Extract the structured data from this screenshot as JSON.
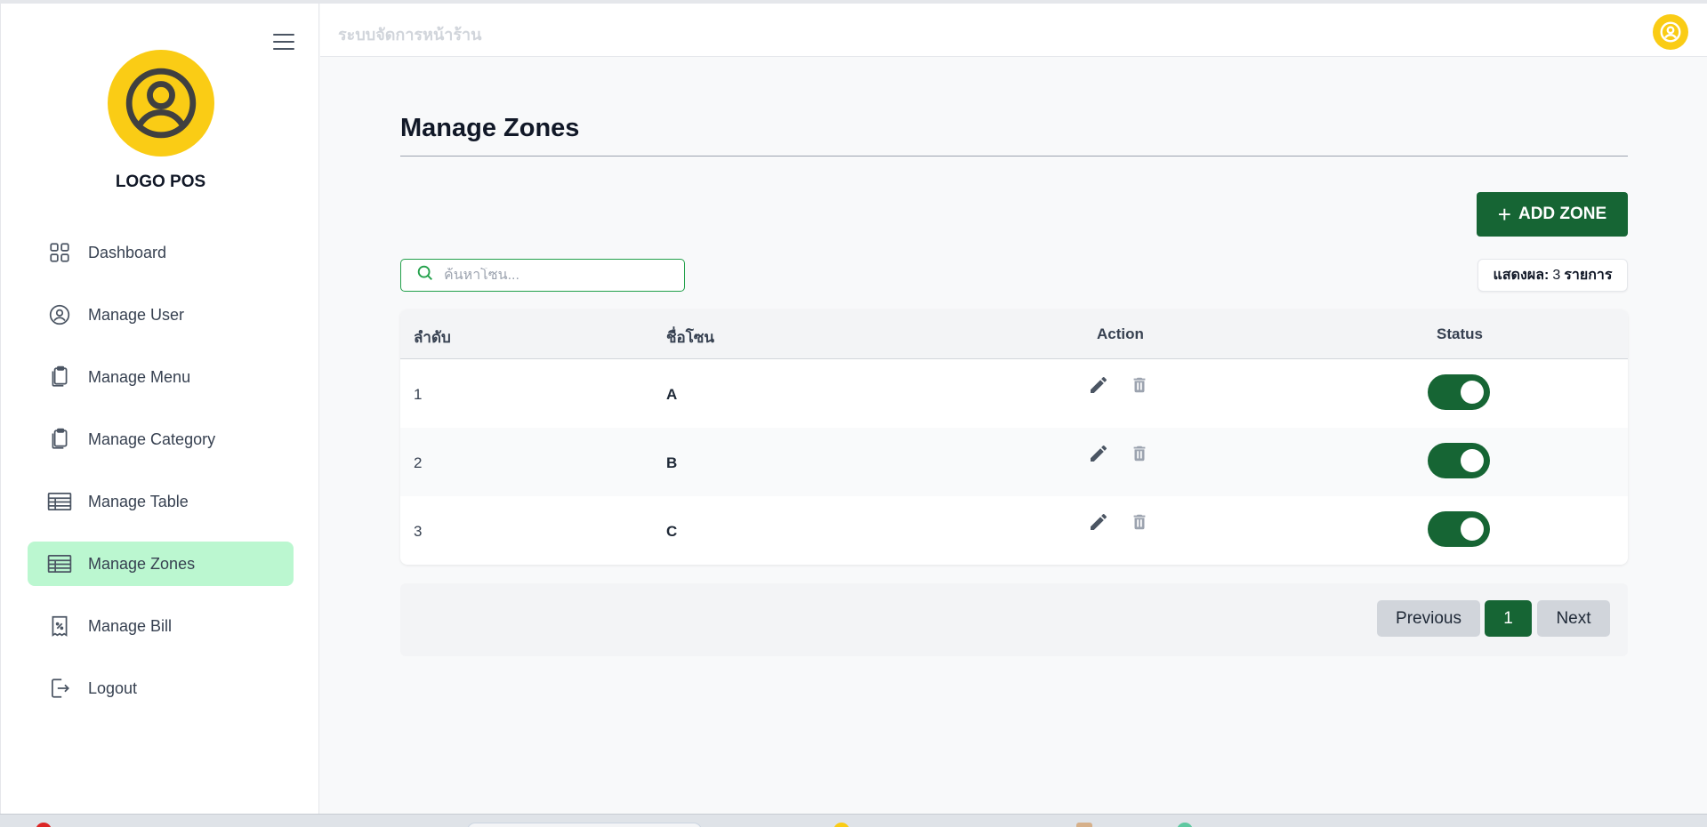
{
  "header": {
    "title": "ระบบจัดการหน้าร้าน"
  },
  "brand": {
    "logo_text": "LOGO POS"
  },
  "sidebar": {
    "items": [
      {
        "label": "Dashboard",
        "icon": "grid-icon",
        "active": false
      },
      {
        "label": "Manage User",
        "icon": "user-circle-icon",
        "active": false
      },
      {
        "label": "Manage Menu",
        "icon": "clipboard-icon",
        "active": false
      },
      {
        "label": "Manage Category",
        "icon": "clipboard-icon",
        "active": false
      },
      {
        "label": "Manage Table",
        "icon": "table-icon",
        "active": false
      },
      {
        "label": "Manage Zones",
        "icon": "table-icon",
        "active": true
      },
      {
        "label": "Manage Bill",
        "icon": "receipt-icon",
        "active": false
      },
      {
        "label": "Logout",
        "icon": "logout-icon",
        "active": false
      }
    ]
  },
  "main": {
    "title": "Manage Zones",
    "add_button": "ADD ZONE",
    "search": {
      "placeholder": "ค้นหาโซน...",
      "value": ""
    },
    "count": {
      "label": "แสดงผล:",
      "value": "3",
      "unit": "รายการ"
    },
    "table": {
      "columns": {
        "index": "ลำดับ",
        "name": "ชื่อโซน",
        "action": "Action",
        "status": "Status"
      },
      "rows": [
        {
          "index": "1",
          "name": "A",
          "status_on": true
        },
        {
          "index": "2",
          "name": "B",
          "status_on": true
        },
        {
          "index": "3",
          "name": "C",
          "status_on": true
        }
      ]
    },
    "pagination": {
      "previous": "Previous",
      "current": "1",
      "next": "Next"
    }
  },
  "colors": {
    "accent": "#166534",
    "active_nav": "#bbf7d0",
    "avatar": "#facc15",
    "search_border": "#22a04a"
  }
}
